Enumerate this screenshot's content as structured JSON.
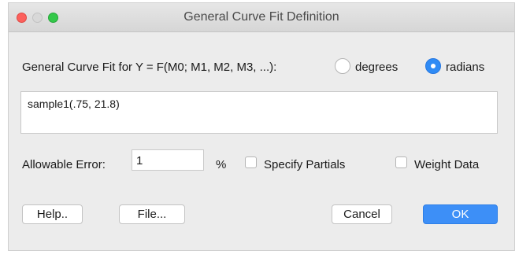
{
  "window": {
    "title": "General Curve Fit Definition"
  },
  "definition": {
    "label": "General Curve Fit for Y = F(M0; M1, M2, M3, ...):",
    "angle_units": {
      "options": [
        "degrees",
        "radians"
      ],
      "selected": "radians"
    },
    "formula": "sample1(.75, 21.8)"
  },
  "error": {
    "label": "Allowable Error:",
    "value": "1",
    "unit": "%"
  },
  "options": {
    "specify_partials": {
      "label": "Specify Partials",
      "checked": false
    },
    "weight_data": {
      "label": "Weight Data",
      "checked": false
    }
  },
  "buttons": {
    "help": "Help..",
    "file": "File...",
    "cancel": "Cancel",
    "ok": "OK"
  },
  "colors": {
    "accent": "#3d8ff7",
    "close_light": "#fc605c",
    "zoom_light": "#34c84a"
  }
}
